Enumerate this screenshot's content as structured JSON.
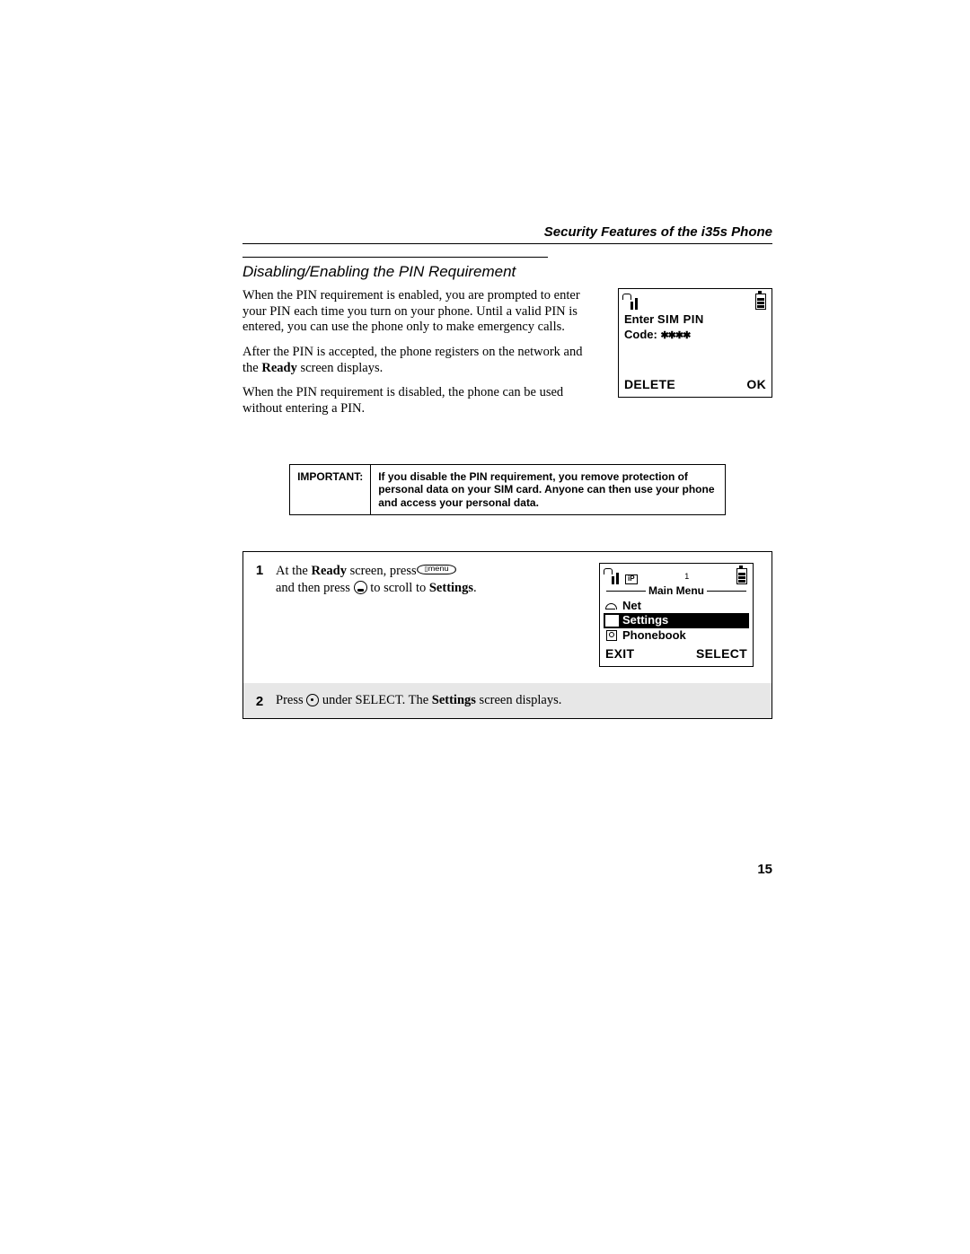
{
  "header": {
    "running_title": "Security Features of the i35s Phone"
  },
  "section_heading": "Disabling/Enabling the PIN Requirement",
  "intro_paragraphs": {
    "p1_a": "When the PIN requirement is enabled, you are prompted to enter your PIN each time you turn on your phone. Until a valid PIN is entered, you can use the phone only to make emergency calls.",
    "p2_a": "After the PIN is accepted, the phone registers on the network and the ",
    "p2_bold": "Ready",
    "p2_b": " screen displays.",
    "p3": "When the PIN requirement is disabled, the phone can be used without entering a PIN."
  },
  "phone_screen_pin": {
    "line1_a": "Enter ",
    "line1_b": "SIM PIN",
    "line2_label": "Code: ",
    "line2_value": "✱✱✱✱",
    "softkey_left": "DELETE",
    "softkey_right": "OK"
  },
  "important_box": {
    "label": "IMPORTANT:",
    "text": "If you disable the PIN requirement, you remove protection of personal data on your SIM card. Anyone can then use your phone and access your personal data."
  },
  "step1": {
    "num": "1",
    "text_a": "At the ",
    "text_bold1": "Ready",
    "text_b": " screen, press ",
    "key_menu_label": "menu",
    "text_c": " and then press ",
    "text_d": " to scroll to ",
    "text_bold2": "Settings",
    "text_e": "."
  },
  "phone_screen_menu": {
    "status_num": "1",
    "title": "Main Menu",
    "item_net": "Net",
    "item_settings": "Settings",
    "item_phonebook": "Phonebook",
    "softkey_left": "EXIT",
    "softkey_right": "SELECT"
  },
  "step2": {
    "num": "2",
    "text_a": "Press ",
    "text_b": " under SELECT. The ",
    "text_bold": "Settings",
    "text_c": " screen displays."
  },
  "page_number": "15"
}
